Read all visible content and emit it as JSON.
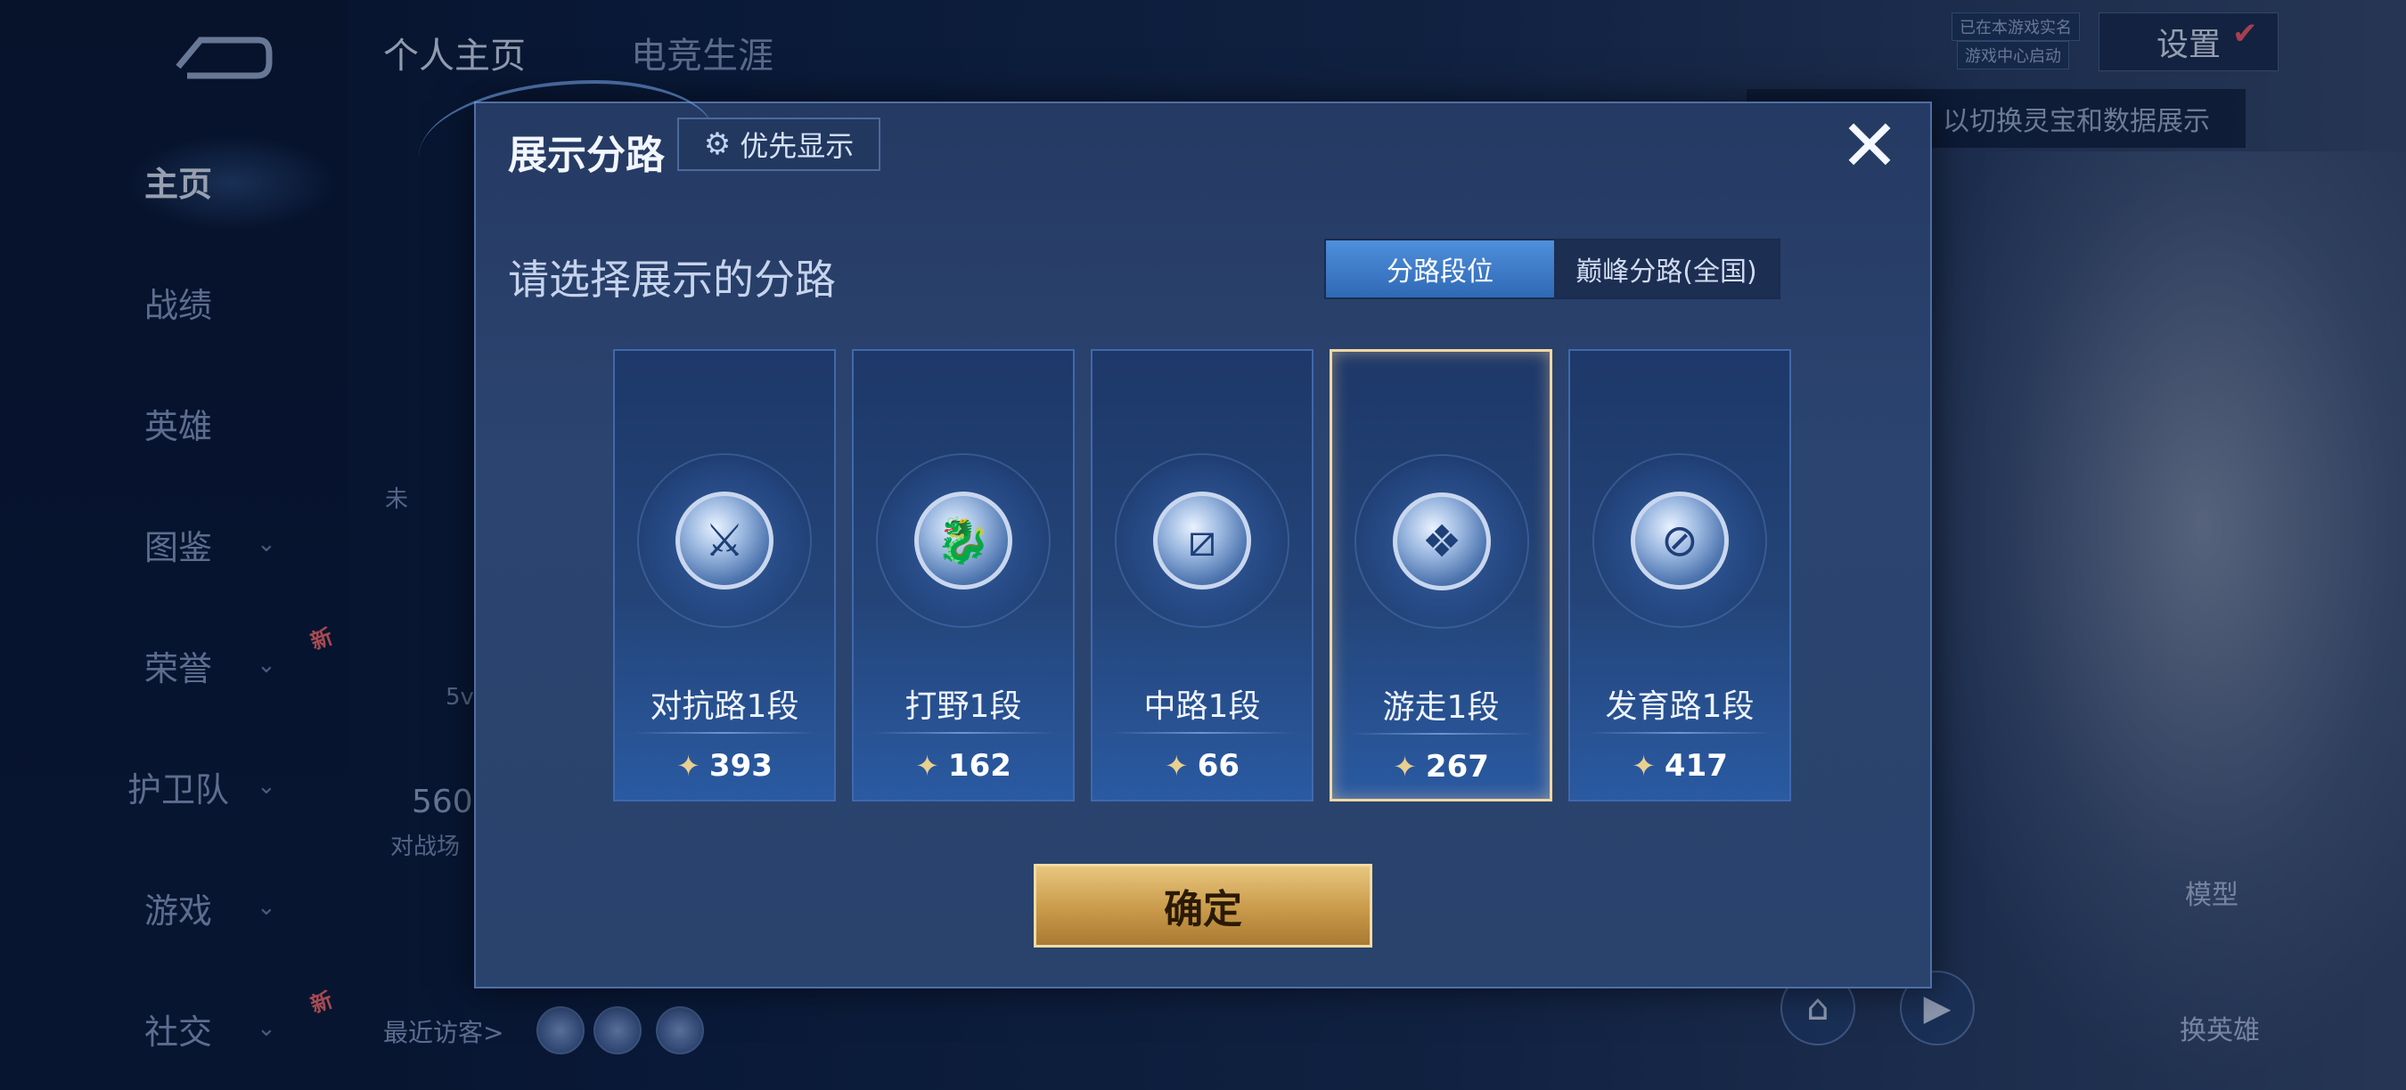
{
  "nav": {
    "items": [
      {
        "label": "主页",
        "active": true,
        "chevron": false,
        "new": false
      },
      {
        "label": "战绩",
        "active": false,
        "chevron": false,
        "new": false
      },
      {
        "label": "英雄",
        "active": false,
        "chevron": false,
        "new": false
      },
      {
        "label": "图鉴",
        "active": false,
        "chevron": true,
        "new": false
      },
      {
        "label": "荣誉",
        "active": false,
        "chevron": true,
        "new": true
      },
      {
        "label": "护卫队",
        "active": false,
        "chevron": true,
        "new": false
      },
      {
        "label": "游戏",
        "active": false,
        "chevron": true,
        "new": false
      },
      {
        "label": "社交",
        "active": false,
        "chevron": true,
        "new": true
      }
    ],
    "chevron_glyph": "⌄",
    "new_badge": "新"
  },
  "header": {
    "tabs": [
      "个人主页",
      "电竞生涯"
    ],
    "settings_label": "设置",
    "status_tags": [
      "已在本游戏实名",
      "游戏中心启动"
    ],
    "info_banner": "以切换灵宝和数据展示"
  },
  "background": {
    "stat_value": "560",
    "stat_label": "对战场",
    "number_5": "5v",
    "status_text": "未",
    "visitors_label": "最近访客>",
    "right_icons": [
      "模型",
      "换英雄"
    ]
  },
  "modal": {
    "title": "展示分路",
    "priority_label": "优先显示",
    "close_glyph": "✕",
    "subtitle": "请选择展示的分路",
    "toggle": {
      "options": [
        "分路段位",
        "巅峰分路(全国)"
      ],
      "selected": 0
    },
    "cards": [
      {
        "name": "对抗路1段",
        "score": "393",
        "icon": "clash-lane-icon",
        "glyph": "⚔",
        "selected": false
      },
      {
        "name": "打野1段",
        "score": "162",
        "icon": "jungle-icon",
        "glyph": "🐉",
        "selected": false
      },
      {
        "name": "中路1段",
        "score": "66",
        "icon": "mid-lane-icon",
        "glyph": "⧄",
        "selected": false
      },
      {
        "name": "游走1段",
        "score": "267",
        "icon": "roam-icon",
        "glyph": "❖",
        "selected": true
      },
      {
        "name": "发育路1段",
        "score": "417",
        "icon": "farm-lane-icon",
        "glyph": "⊘",
        "selected": false
      }
    ],
    "points_glyph": "✦",
    "confirm_label": "确定"
  },
  "colors": {
    "accent_blue": "#3f7fcf",
    "gold": "#d4aa5c",
    "selected_border": "#f1d7a2"
  }
}
